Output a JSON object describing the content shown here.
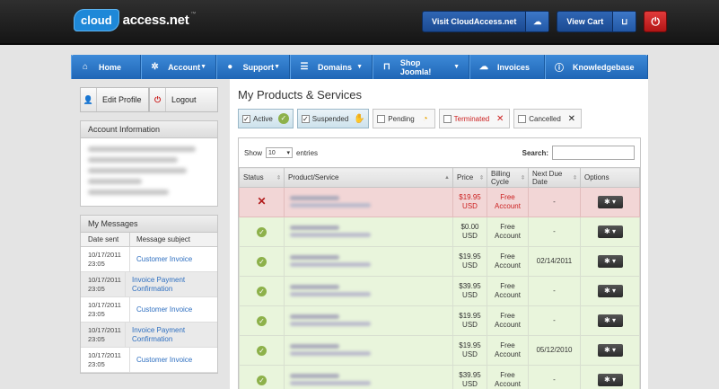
{
  "brand": {
    "cloud": "cloud",
    "name": "access.net",
    "tm": "™"
  },
  "header": {
    "visit_label": "Visit CloudAccess.net",
    "cart_label": "View Cart"
  },
  "nav": [
    {
      "label": "Home",
      "icon": "home-icon",
      "glyph": "⌂",
      "caret": false
    },
    {
      "label": "Account",
      "icon": "gear-icon",
      "glyph": "✲",
      "caret": true
    },
    {
      "label": "Support",
      "icon": "chat-icon",
      "glyph": "●",
      "caret": true
    },
    {
      "label": "Domains",
      "icon": "list-icon",
      "glyph": "☰",
      "caret": true
    },
    {
      "label": "Shop Joomla!",
      "icon": "cart-icon",
      "glyph": "⊓",
      "caret": true
    },
    {
      "label": "Invoices",
      "icon": "cloud-icon",
      "glyph": "☁",
      "caret": false
    },
    {
      "label": "Knowledgebase",
      "icon": "info-icon",
      "glyph": "ⓘ",
      "caret": false
    }
  ],
  "sidebar": {
    "edit_profile": "Edit Profile",
    "logout": "Logout",
    "account_info_title": "Account Information",
    "messages_title": "My Messages",
    "messages_cols": [
      "Date sent",
      "Message subject"
    ],
    "messages": [
      {
        "date": "10/17/2011",
        "time": "23:05",
        "subject": "Customer Invoice"
      },
      {
        "date": "10/17/2011",
        "time": "23:05",
        "subject": "Invoice Payment Confirmation"
      },
      {
        "date": "10/17/2011",
        "time": "23:05",
        "subject": "Customer Invoice"
      },
      {
        "date": "10/17/2011",
        "time": "23:05",
        "subject": "Invoice Payment Confirmation"
      },
      {
        "date": "10/17/2011",
        "time": "23:05",
        "subject": "Customer Invoice"
      }
    ]
  },
  "main": {
    "title": "My Products & Services",
    "filters": [
      {
        "label": "Active",
        "checked": true,
        "icon": "check-circle-icon"
      },
      {
        "label": "Suspended",
        "checked": true,
        "icon": "hand-icon"
      },
      {
        "label": "Pending",
        "checked": false,
        "icon": "clock-icon"
      },
      {
        "label": "Terminated",
        "checked": false,
        "icon": "x-icon"
      },
      {
        "label": "Cancelled",
        "checked": false,
        "icon": "x-icon"
      }
    ],
    "show_label": "Show",
    "entries_value": "10",
    "entries_label": "entries",
    "search_label": "Search:",
    "columns": [
      "Status",
      "Product/Service",
      "Price",
      "Billing Cycle",
      "Next Due Date",
      "Options"
    ],
    "rows": [
      {
        "status": "suspended",
        "price": "$19.95",
        "currency": "USD",
        "cycle": "Free Account",
        "due": "-"
      },
      {
        "status": "active",
        "price": "$0.00",
        "currency": "USD",
        "cycle": "Free Account",
        "due": "-"
      },
      {
        "status": "active",
        "price": "$19.95",
        "currency": "USD",
        "cycle": "Free Account",
        "due": "02/14/2011"
      },
      {
        "status": "active",
        "price": "$39.95",
        "currency": "USD",
        "cycle": "Free Account",
        "due": "-"
      },
      {
        "status": "active",
        "price": "$19.95",
        "currency": "USD",
        "cycle": "Free Account",
        "due": "-"
      },
      {
        "status": "active",
        "price": "$19.95",
        "currency": "USD",
        "cycle": "Free Account",
        "due": "05/12/2010"
      },
      {
        "status": "active",
        "price": "$39.95",
        "currency": "USD",
        "cycle": "Free Account",
        "due": "-"
      }
    ]
  }
}
